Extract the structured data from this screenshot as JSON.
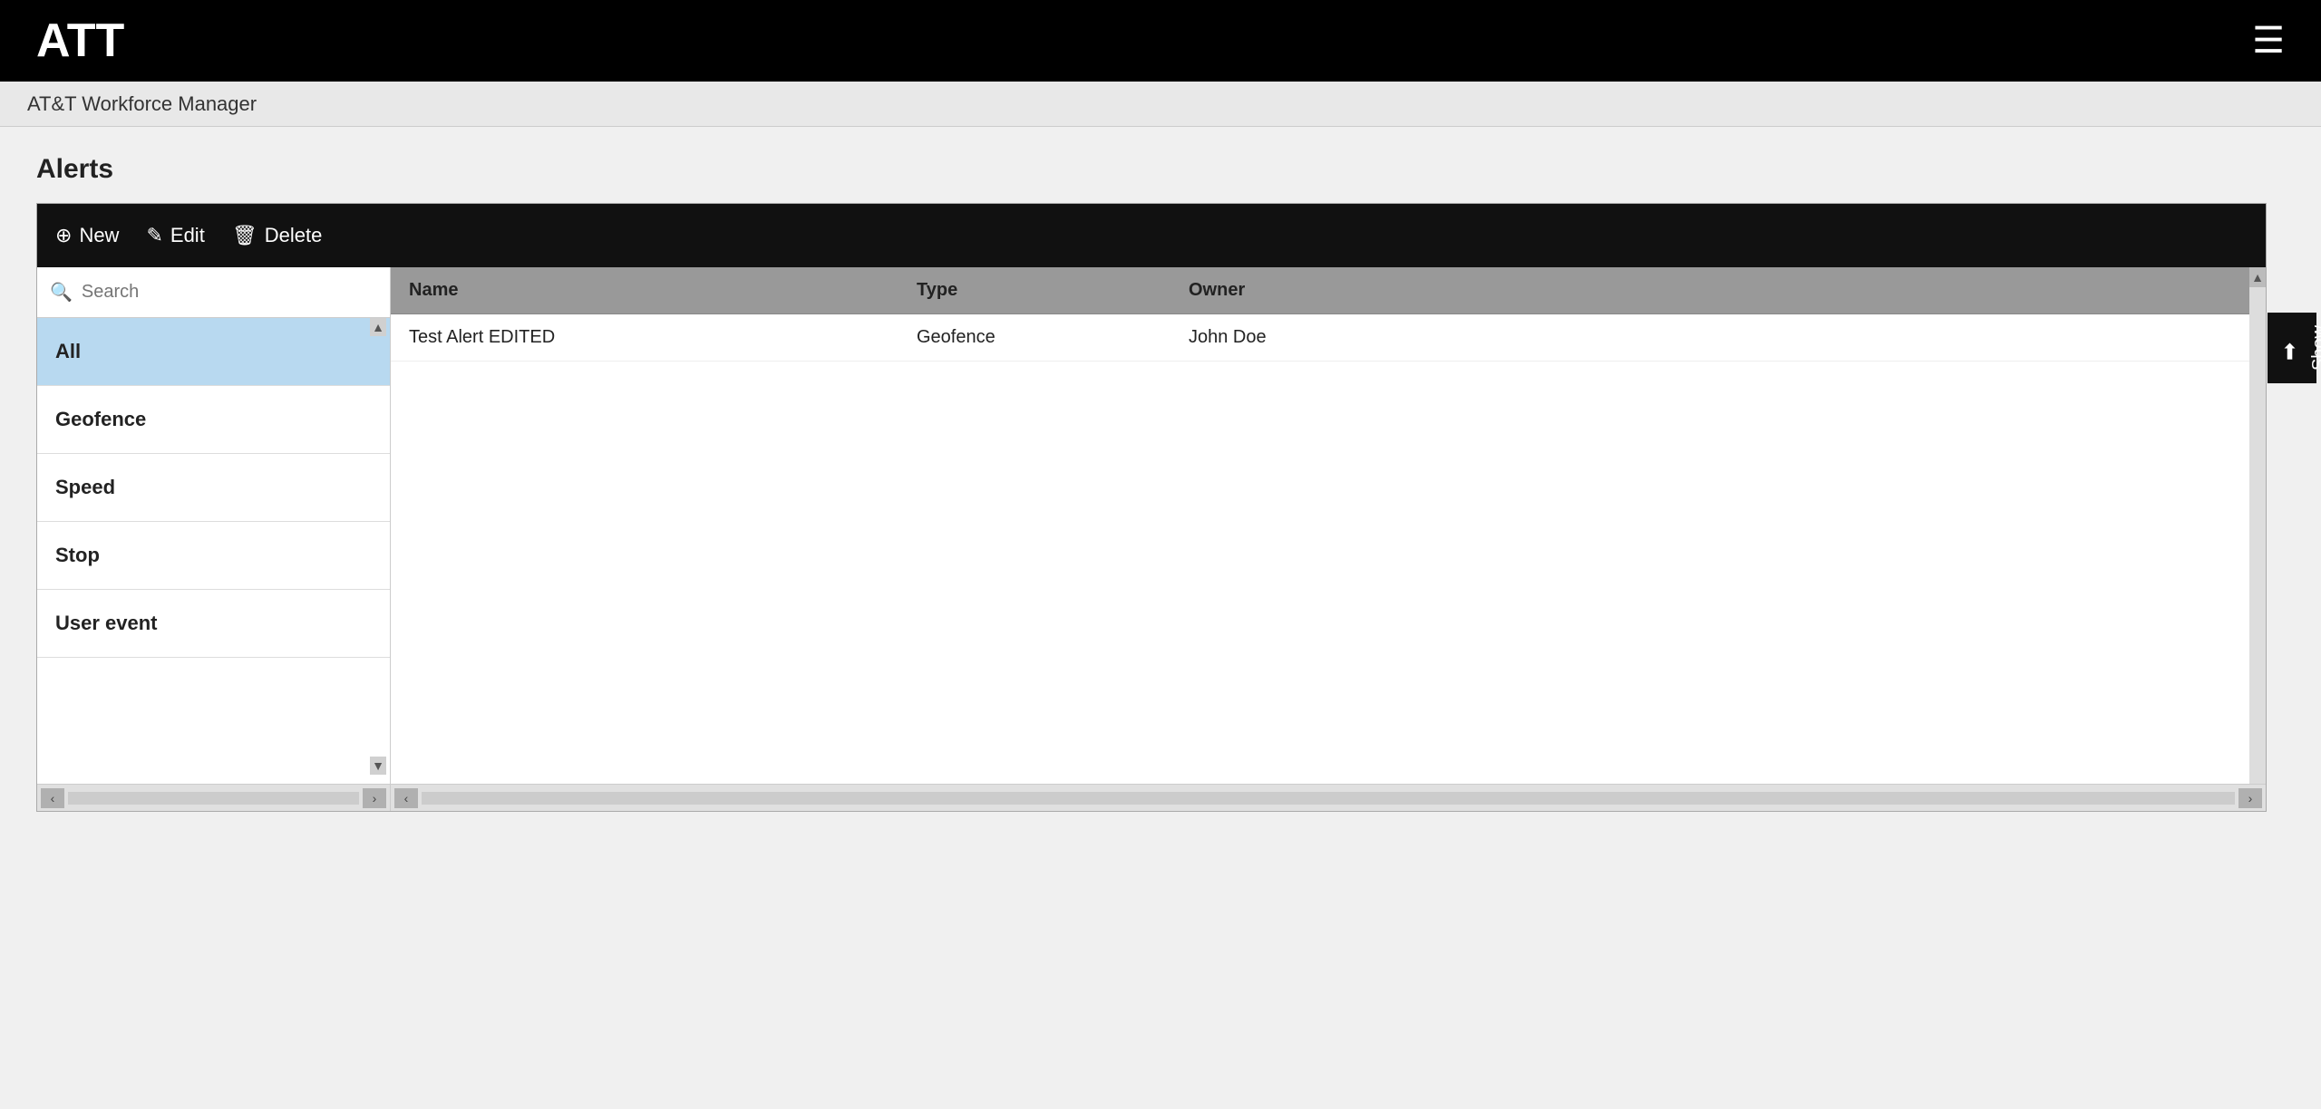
{
  "app": {
    "logo": "ATT",
    "menu_icon": "☰",
    "breadcrumb": "AT&T Workforce Manager"
  },
  "page": {
    "title": "Alerts"
  },
  "toolbar": {
    "new_label": "New",
    "edit_label": "Edit",
    "delete_label": "Delete"
  },
  "sidebar": {
    "search_placeholder": "Search",
    "items": [
      {
        "id": "all",
        "label": "All",
        "active": true
      },
      {
        "id": "geofence",
        "label": "Geofence",
        "active": false
      },
      {
        "id": "speed",
        "label": "Speed",
        "active": false
      },
      {
        "id": "stop",
        "label": "Stop",
        "active": false
      },
      {
        "id": "user-event",
        "label": "User event",
        "active": false
      }
    ]
  },
  "table": {
    "columns": [
      {
        "id": "name",
        "label": "Name"
      },
      {
        "id": "type",
        "label": "Type"
      },
      {
        "id": "owner",
        "label": "Owner"
      }
    ],
    "rows": [
      {
        "name": "Test Alert EDITED",
        "type": "Geofence",
        "owner": "John Doe"
      }
    ]
  },
  "show_panel": {
    "arrow": "←",
    "label": "Show"
  }
}
